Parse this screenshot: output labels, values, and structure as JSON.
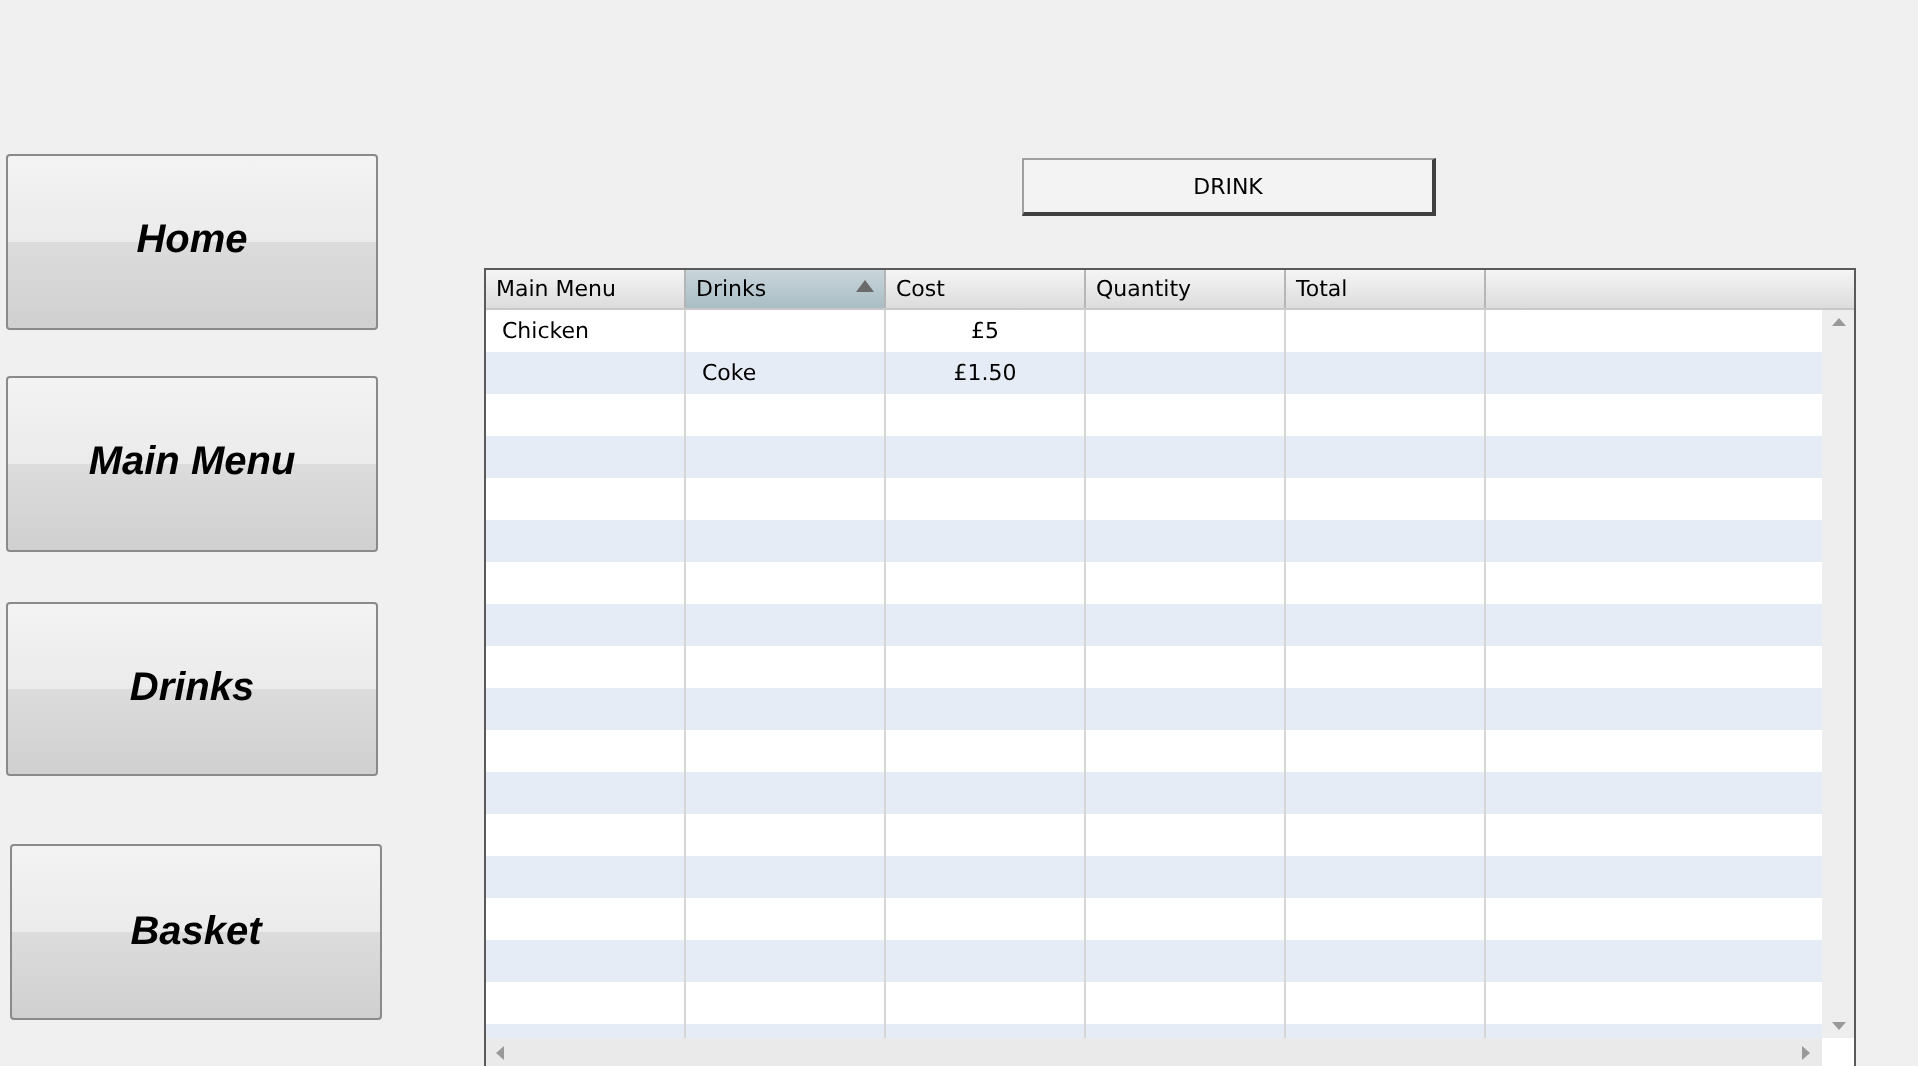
{
  "nav_buttons": [
    {
      "label": "Home"
    },
    {
      "label": "Main Menu"
    },
    {
      "label": "Drinks"
    },
    {
      "label": "Basket"
    }
  ],
  "action_button": {
    "label": "DRINK"
  },
  "table": {
    "columns": [
      {
        "label": "Main Menu",
        "sorted": false
      },
      {
        "label": "Drinks",
        "sorted": true
      },
      {
        "label": "Cost",
        "sorted": false
      },
      {
        "label": "Quantity",
        "sorted": false
      },
      {
        "label": "Total",
        "sorted": false
      }
    ],
    "rows": [
      {
        "cells": [
          "Chicken",
          "",
          "£5",
          "",
          ""
        ]
      },
      {
        "cells": [
          "",
          "Coke",
          "£1.50",
          "",
          ""
        ]
      }
    ]
  }
}
